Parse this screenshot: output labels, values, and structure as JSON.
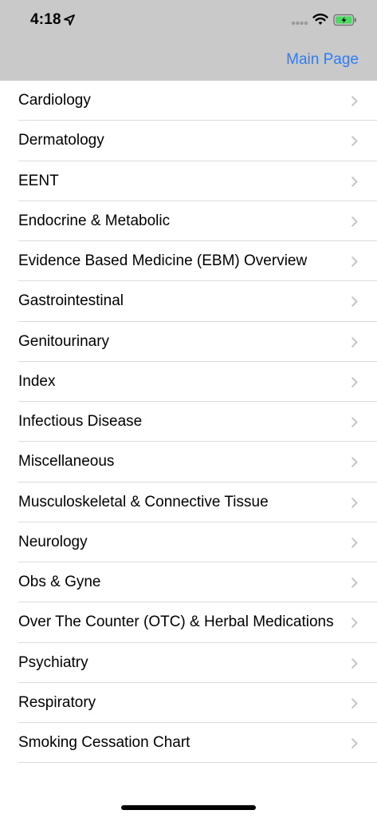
{
  "status_bar": {
    "time": "4:18",
    "location_icon": "location-arrow-icon",
    "signal_icon": "cellular-signal-icon",
    "wifi_icon": "wifi-icon",
    "battery_icon": "battery-charging-icon"
  },
  "nav": {
    "right_link": "Main Page"
  },
  "colors": {
    "nav_bar_bg": "#c9c9c9",
    "link": "#2f7cf6",
    "separator": "#dcdcdc",
    "chevron": "#c4c4c7",
    "battery_fill": "#4cd964"
  },
  "list": {
    "chevron_icon": "chevron-right-icon",
    "items": [
      {
        "label": "Cardiology"
      },
      {
        "label": "Dermatology"
      },
      {
        "label": "EENT"
      },
      {
        "label": "Endocrine & Metabolic"
      },
      {
        "label": "Evidence Based Medicine (EBM) Overview"
      },
      {
        "label": "Gastrointestinal"
      },
      {
        "label": "Genitourinary"
      },
      {
        "label": "Index"
      },
      {
        "label": "Infectious Disease"
      },
      {
        "label": "Miscellaneous"
      },
      {
        "label": "Musculoskeletal & Connective Tissue"
      },
      {
        "label": "Neurology"
      },
      {
        "label": "Obs & Gyne"
      },
      {
        "label": "Over The Counter (OTC) & Herbal Medications"
      },
      {
        "label": "Psychiatry"
      },
      {
        "label": "Respiratory"
      },
      {
        "label": "Smoking Cessation Chart"
      }
    ]
  }
}
